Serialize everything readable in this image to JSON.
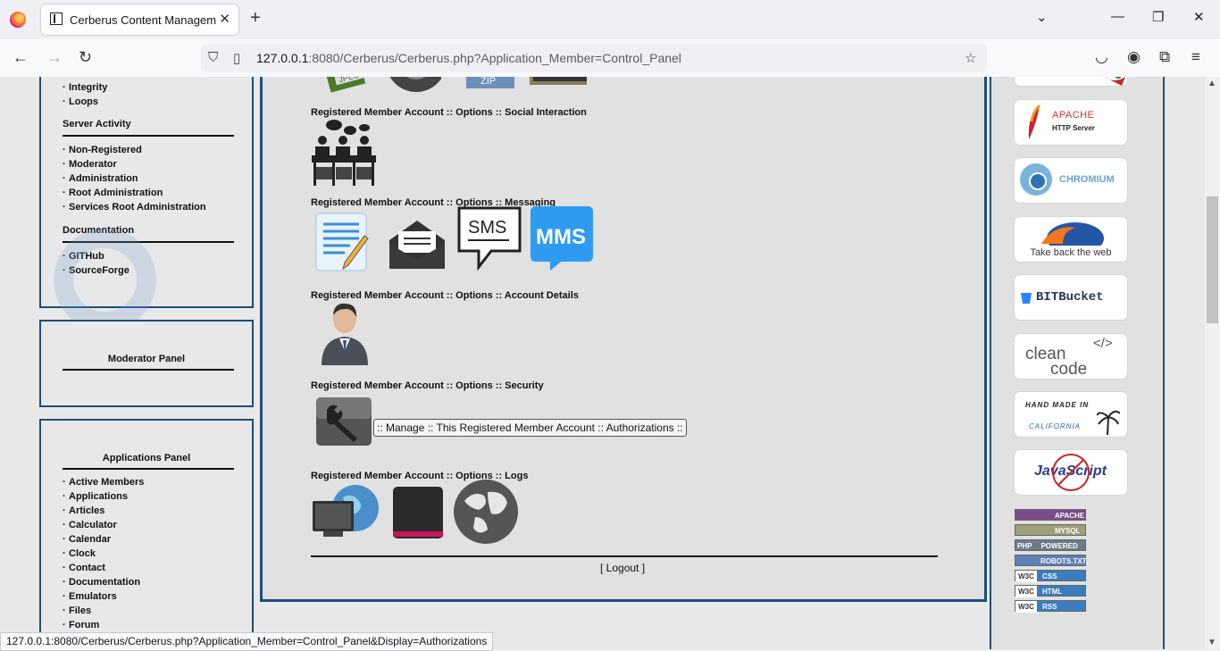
{
  "browser": {
    "tab_title": "Cerberus Content Management",
    "url_host": "127.0.0.1",
    "url_rest": ":8080/Cerberus/Cerberus.php?Application_Member=Control_Panel",
    "status_url": "127.0.0.1:8080/Cerberus/Cerberus.php?Application_Member=Control_Panel&Display=Authorizations"
  },
  "sidebar": {
    "top_links": [
      "Integrity",
      "Loops"
    ],
    "server_activity": {
      "heading": "Server Activity",
      "links": [
        "Non-Registered",
        "Moderator",
        "Administration",
        "Root Administration",
        "Services Root Administration"
      ]
    },
    "documentation": {
      "heading": "Documentation",
      "links": [
        "GITHub",
        "SourceForge"
      ]
    },
    "moderator_panel": {
      "heading": "Moderator Panel"
    },
    "applications_panel": {
      "heading": "Applications Panel",
      "links": [
        "Active Members",
        "Applications",
        "Articles",
        "Calculator",
        "Calendar",
        "Clock",
        "Contact",
        "Documentation",
        "Emulators",
        "Files",
        "Forum"
      ]
    }
  },
  "main": {
    "sections": [
      "Registered Member Account :: Options :: Social Interaction",
      "Registered Member Account :: Options :: Messaging",
      "Registered Member Account :: Options :: Account Details",
      "Registered Member Account :: Options :: Security",
      "Registered Member Account :: Options :: Logs"
    ],
    "zip_label": "ZIP",
    "jpeg_label": "JPEG",
    "sms_label": "SMS",
    "mms_label": "MMS",
    "tooltip": ":: Manage :: This Registered Member Account :: Authorizations ::",
    "logout_open": "[ ",
    "logout_label": "Logout",
    "logout_close": " ]"
  },
  "right_badges": {
    "apache": "APACHE",
    "apache_sub": "HTTP Server",
    "chromium": "CHROMIUM",
    "firefox": "Take back the web",
    "bitbucket": "BITBucket",
    "cleancode_1": "clean",
    "cleancode_2": "code",
    "cleancode_tag": "</>",
    "handmade_1": "HAND MADE IN",
    "handmade_2": "CALIFORNIA",
    "javascript": "JavaScript",
    "small": [
      {
        "prefix": "",
        "label": "APACHE"
      },
      {
        "prefix": "",
        "label": "MYSQL"
      },
      {
        "prefix": "PHP",
        "label": "POWERED"
      },
      {
        "prefix": "",
        "label": "ROBOTS.TXT"
      },
      {
        "prefix": "W3C",
        "label": "CSS"
      },
      {
        "prefix": "W3C",
        "label": "HTML"
      },
      {
        "prefix": "W3C",
        "label": "RSS"
      }
    ]
  }
}
